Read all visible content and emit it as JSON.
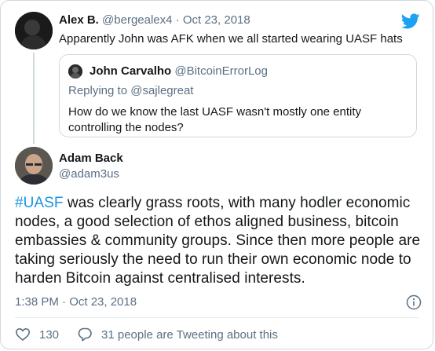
{
  "parent": {
    "name": "Alex B.",
    "handle": "@bergealex4",
    "separator": "·",
    "date": "Oct 23, 2018",
    "text": "Apparently John was AFK when we all started wearing UASF hats"
  },
  "quote": {
    "name": "John Carvalho",
    "handle": "@BitcoinErrorLog",
    "replying_to": "Replying to @sajlegreat",
    "text": "How do we know the last UASF wasn't mostly one entity controlling the nodes?"
  },
  "tweet": {
    "name": "Adam Back",
    "handle": "@adam3us",
    "hashtag": "#UASF",
    "text": " was clearly grass roots, with many hodler economic nodes, a good selection of ethos aligned business, bitcoin embassies & community groups. Since then more people are taking seriously the need to run their own economic node to harden Bitcoin against centralised interests.",
    "timestamp": "1:38 PM · Oct 23, 2018",
    "likes": "130",
    "tweeting": "31 people are Tweeting about this"
  },
  "colors": {
    "accent": "#1b95e0",
    "muted": "#5b7083",
    "border": "#cfd9de"
  },
  "icons": [
    "twitter-bird-icon",
    "info-icon",
    "heart-icon",
    "speech-bubble-icon"
  ]
}
